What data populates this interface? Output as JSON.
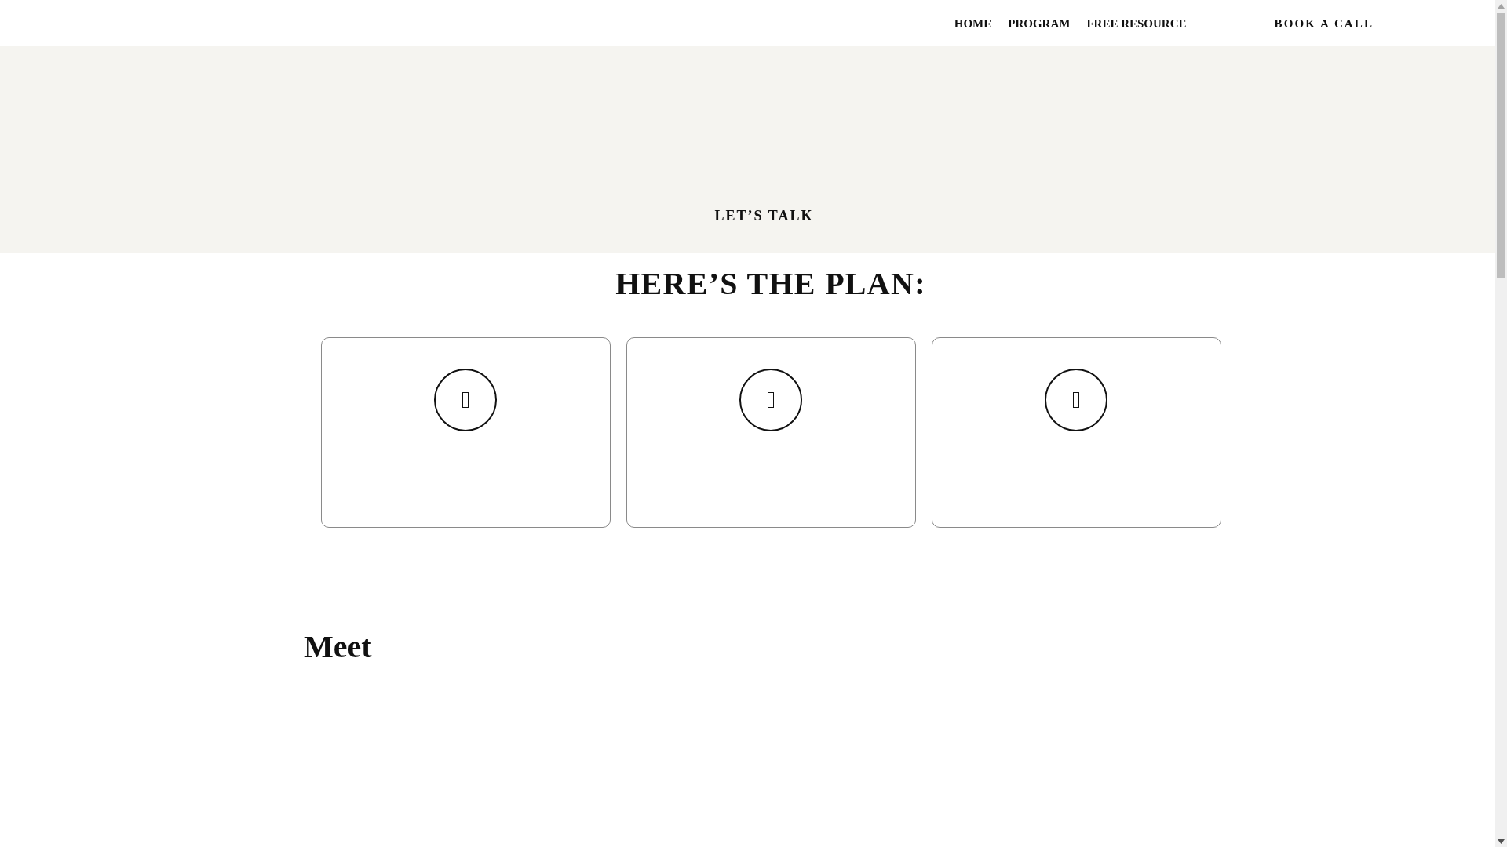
{
  "nav": {
    "items": [
      {
        "label": "HOME"
      },
      {
        "label": "PROGRAM"
      },
      {
        "label": "FREE RESOURCE"
      }
    ],
    "cta": "BOOK A CALL"
  },
  "hero": {
    "link": "LET’S TALK"
  },
  "plan": {
    "title": "HERE’S THE PLAN:",
    "cards": [
      {
        "kind": "icon"
      },
      {
        "kind": "icon"
      },
      {
        "kind": "icon"
      }
    ]
  },
  "meet": {
    "title": "Meet"
  }
}
